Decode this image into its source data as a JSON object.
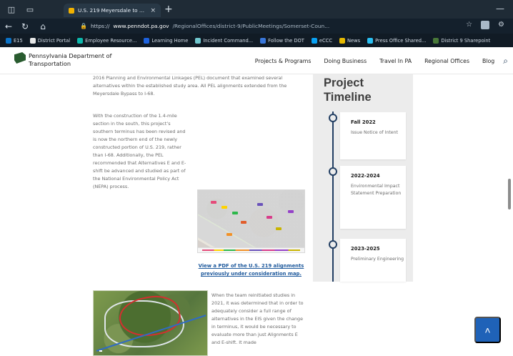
{
  "browser": {
    "tab_title": "U.S. 219 Meyersdale to Old Sal...",
    "address_prefix": "https://",
    "address_domain": "www.penndot.pa.gov",
    "address_path": "/RegionalOffices/district-9/PublicMeetings/Somerset-Coun...",
    "toolbar_icons": [
      "back-icon",
      "refresh-icon",
      "home-icon",
      "lock-icon",
      "favorites-icon",
      "settings-icon"
    ],
    "bookmarks": [
      {
        "label": "E15",
        "icon": "E15"
      },
      {
        "label": "District Portal",
        "icon": "page-icon"
      },
      {
        "label": "Employee Resource...",
        "icon": "teal-icon"
      },
      {
        "label": "Learning Home",
        "icon": "blue-icon"
      },
      {
        "label": "Incident Command...",
        "icon": "blue-icon"
      },
      {
        "label": "Follow the DOT",
        "icon": "blue-icon"
      },
      {
        "label": "eCCC",
        "icon": "blue-icon"
      },
      {
        "label": "News",
        "icon": "yellow-icon"
      },
      {
        "label": "Press Office Shared...",
        "icon": "cloud-icon"
      },
      {
        "label": "District 9 Sharepoint",
        "icon": "green-icon"
      }
    ]
  },
  "site": {
    "brand_line1": "Pennsylvania Department of",
    "brand_line2": "Transportation",
    "menu": [
      "Projects & Programs",
      "Doing Business",
      "Travel In PA",
      "Regional Offices",
      "Blog"
    ],
    "search_icon": "search-icon"
  },
  "content": {
    "lead_paragraph": "2016 Planning and Environmental Linkages (PEL) document that examined several alternatives within the established study area. All PEL alignments extended from the Meyersdale Bypass to I-68.",
    "left_paragraph": "With the construction of the 1.4-mile section in the south, this project’s southern terminus has been revised and is now the northern end of the newly constructed portion of U.S. 219, rather than I-68. Additionally, the PEL recommended that Alternatives E and E-shift be advanced and studied as part of the National Environmental Policy Act (NEPA) process.",
    "map_link_text": "View a PDF of the U.S. 219 alignments previously under consideration map.",
    "right_paragraph": "When the team reinitiated studies in 2021, it was determined that in order to adequately consider a full range of alternatives in the EIS given the change in terminus, it would be necessary to evaluate more than just Alignments E and E-shift. It made"
  },
  "timeline": {
    "title_line1": "Project",
    "title_line2": "Timeline",
    "items": [
      {
        "date": "Fall 2022",
        "text": "Issue Notice of Intent"
      },
      {
        "date": "2022-2024",
        "text": "Environmental Impact Statement Preparation"
      },
      {
        "date": "2023-2025",
        "text": "Preliminary Engineering"
      }
    ]
  },
  "controls": {
    "scroll_to_top_icon": "chevron-up-icon"
  }
}
